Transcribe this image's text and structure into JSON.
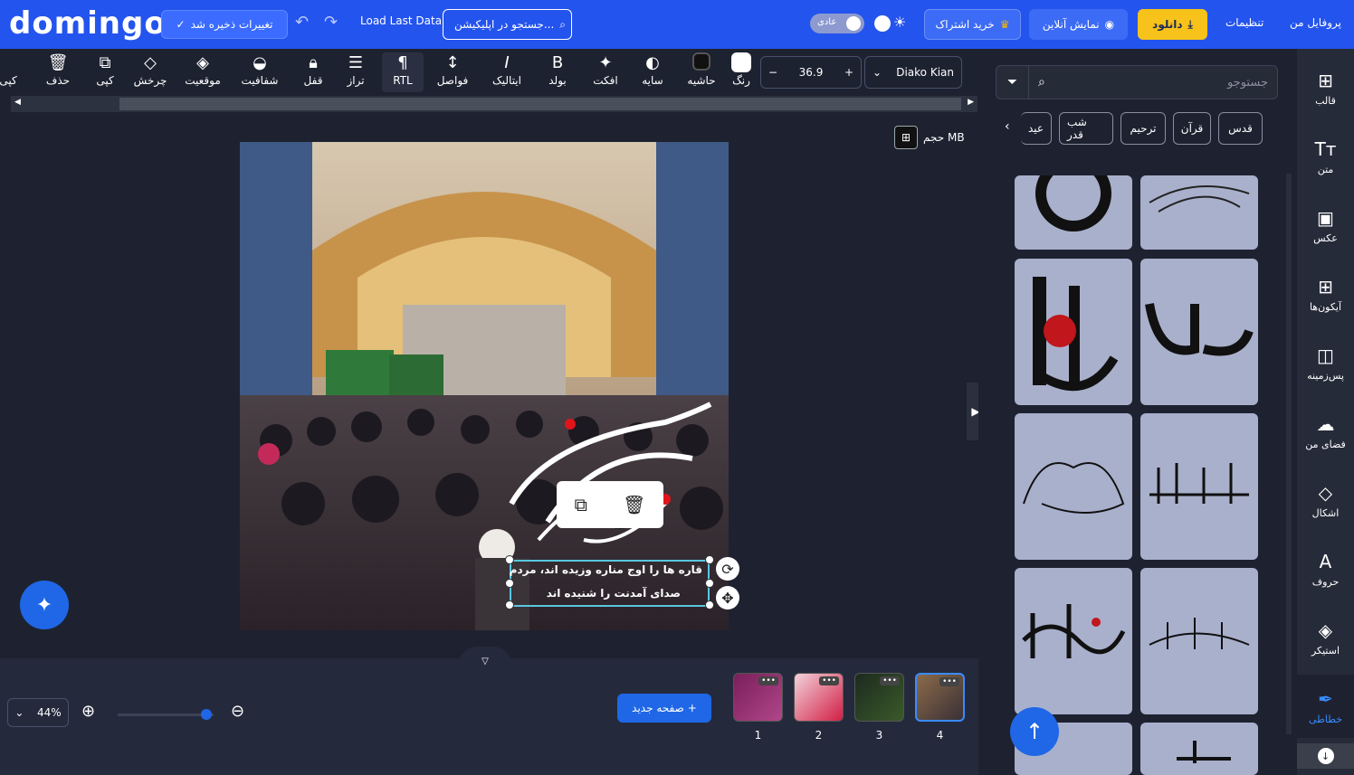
{
  "app": {
    "logo": "domingo",
    "saved_label": "تغییرات ذخیره شد",
    "load_last": "Load Last Data",
    "app_search": "جستجو در اپلیکیشن...",
    "theme_label": "عادی",
    "subscribe": "خرید اشتراک",
    "online": "نمایش آنلاین",
    "download": "دانلود",
    "settings": "تنظیمات",
    "profile": "پروفایل من"
  },
  "toolbar": {
    "copy_right": "کپی",
    "delete": "حذف",
    "copy": "کپی",
    "rotate": "چرخش",
    "position": "موقعیت",
    "opacity": "شفافیت",
    "lock": "قفل",
    "align": "تراز",
    "rtl": "RTL",
    "spacing": "فواصل",
    "italic": "ایتالیک",
    "bold": "بولد",
    "effect": "افکت",
    "shadow": "سایه",
    "border": "حاشیه",
    "color": "رنگ",
    "font_size": "36.9",
    "font_name": "Diako Kian"
  },
  "canvas": {
    "size_label": "حجم MB",
    "text_line1": "قاره ها را اوج مناره وزیده اند، مردم",
    "text_line2": "صدای آمدنت را شنیده اند"
  },
  "bottom": {
    "zoom": "44%",
    "new_page": "صفحه جدید",
    "pages": [
      "1",
      "2",
      "3",
      "4"
    ]
  },
  "right": {
    "search_placeholder": "جستوجو",
    "categories": [
      "قدس",
      "قرآن",
      "ترحیم",
      "شب قدر",
      "عید"
    ]
  },
  "nav": {
    "template": "قالب",
    "text": "متن",
    "photo": "عکس",
    "icons": "آیکون‌ها",
    "background": "پس‌زمینه",
    "myspace": "فضای من",
    "shapes": "اشکال",
    "letters": "حروف",
    "sticker": "استیکر",
    "calligraphy": "خطاطی"
  },
  "colors": {
    "brand": "#2454ee",
    "accent": "#1f67e6",
    "download": "#f7c21a"
  }
}
